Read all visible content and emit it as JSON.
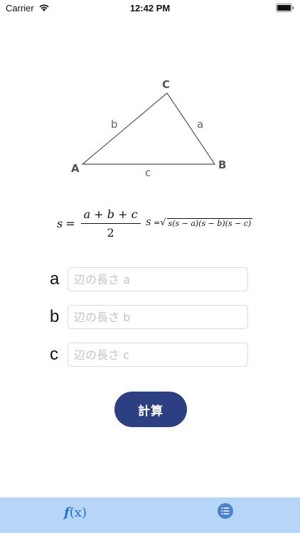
{
  "status_bar": {
    "carrier": "Carrier",
    "time": "12:42 PM"
  },
  "diagram": {
    "vertex_a": "A",
    "vertex_b": "B",
    "vertex_c": "C",
    "side_a": "a",
    "side_b": "b",
    "side_c": "c"
  },
  "formula_s": {
    "lhs": "s",
    "equals": "=",
    "numerator": "a + b + c",
    "denominator": "2"
  },
  "formula_area": {
    "lhs": "S =",
    "radical": "√",
    "radicand": "s(s − a)(s − b)(s − c)"
  },
  "inputs": [
    {
      "label": "a",
      "placeholder": "辺の長さ a",
      "value": ""
    },
    {
      "label": "b",
      "placeholder": "辺の長さ b",
      "value": ""
    },
    {
      "label": "c",
      "placeholder": "辺の長さ c",
      "value": ""
    }
  ],
  "calc_button_label": "計算",
  "tab_bar": {
    "fx_tab": {
      "label_f": "f",
      "label_x": "(x)"
    },
    "list_tab_icon": "list-icon",
    "active_color": "#1f6fe0"
  },
  "colors": {
    "button_bg": "#2c3f83",
    "tab_bar_bg": "#b7d6f7"
  }
}
